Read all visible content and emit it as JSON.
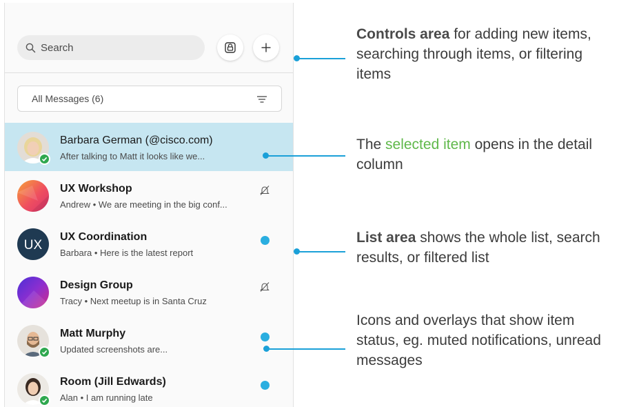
{
  "controls": {
    "search_placeholder": "Search",
    "filter_label": "All Messages (6)"
  },
  "list": [
    {
      "title": "Barbara German (@cisco.com)",
      "subtitle": "After talking to Matt it looks like we...",
      "selected": true,
      "bold": false,
      "status": "online",
      "indicator": "none",
      "avatar": "photo-person"
    },
    {
      "title": "UX Workshop",
      "subtitle": "Andrew • We are meeting in the big conf...",
      "selected": false,
      "bold": true,
      "status": "none",
      "indicator": "muted",
      "avatar": "gradient-orange"
    },
    {
      "title": "UX Coordination",
      "subtitle": "Barbara • Here is the latest report",
      "selected": false,
      "bold": true,
      "status": "none",
      "indicator": "unread",
      "avatar": "initials",
      "initials": "UX"
    },
    {
      "title": "Design Group",
      "subtitle": "Tracy • Next meetup is in Santa Cruz",
      "selected": false,
      "bold": true,
      "status": "none",
      "indicator": "muted",
      "avatar": "gradient-purple"
    },
    {
      "title": "Matt Murphy",
      "subtitle": "Updated screenshots are...",
      "selected": false,
      "bold": true,
      "status": "online",
      "indicator": "unread",
      "avatar": "photo-person"
    },
    {
      "title": "Room (Jill Edwards)",
      "subtitle": "Alan • I am running late",
      "selected": false,
      "bold": true,
      "status": "online",
      "indicator": "unread",
      "avatar": "photo-person"
    }
  ],
  "annotations": {
    "controls": {
      "strong": "Controls area",
      "text": " for adding new items, searching through items, or filtering items"
    },
    "selected": {
      "prefix": "The ",
      "highlight": "selected item",
      "suffix": " opens in the detail column"
    },
    "list": {
      "strong": "List area",
      "text": " shows the whole list, search results, or filtered list"
    },
    "icons": {
      "text": "Icons and overlays that show item status, eg. muted notifications, unread messages"
    }
  },
  "colors": {
    "accent": "#1aa0d8",
    "selected_bg": "#c6e6f1",
    "unread": "#2aaee0",
    "online": "#2fa84f",
    "highlight_text": "#5fb84a"
  },
  "icons": [
    "search-icon",
    "lock-icon",
    "plus-icon",
    "filter-icon",
    "muted-bell-icon",
    "check-icon"
  ]
}
